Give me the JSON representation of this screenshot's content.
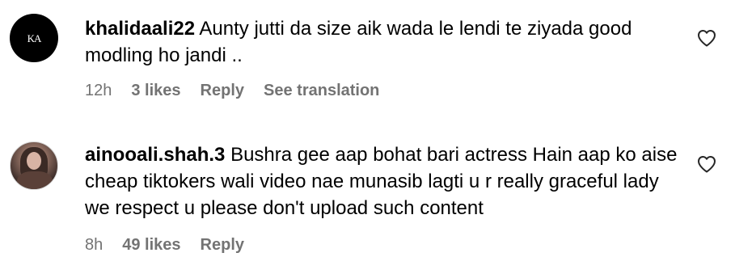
{
  "comments": [
    {
      "username": "khalidaali22",
      "text": "Aunty jutti da size aik wada le lendi te ziyada good modling ho jandi ..",
      "time": "12h",
      "likes": "3 likes",
      "reply_label": "Reply",
      "translation_label": "See translation",
      "avatar": {
        "monogram": "KA",
        "icon": "avatar-monogram"
      },
      "like_icon": "heart-outline-icon"
    },
    {
      "username": "ainooali.shah.3",
      "text": "Bushra gee aap bohat bari actress Hain aap ko aise cheap tiktokers wali video nae munasib lagti u r really graceful lady we respect u please don't upload such content",
      "time": "8h",
      "likes": "49 likes",
      "reply_label": "Reply",
      "avatar": {
        "icon": "avatar-photo"
      },
      "like_icon": "heart-outline-icon"
    }
  ],
  "colors": {
    "text": "#000000",
    "meta": "#737373",
    "background": "#ffffff",
    "avatar_dark": "#000000"
  }
}
